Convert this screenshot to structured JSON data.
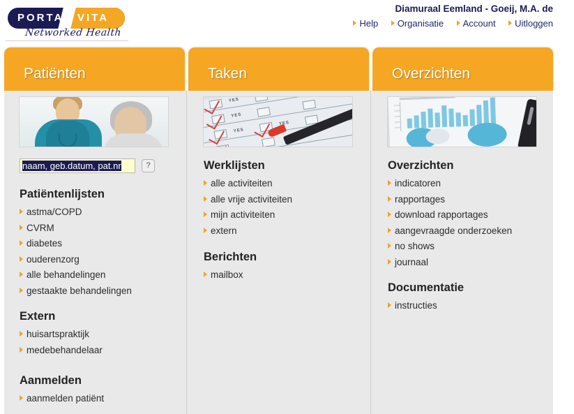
{
  "brand": {
    "logo_left": "PORTA",
    "logo_right": "VITA",
    "tagline": "Networked Health",
    "accent_orange": "#f5a623",
    "navy": "#1b1b54"
  },
  "header": {
    "organisation": "Diamuraal Eemland - Goeij, M.A. de",
    "nav": [
      {
        "label": "Help"
      },
      {
        "label": "Organisatie"
      },
      {
        "label": "Account"
      },
      {
        "label": "Uitloggen"
      }
    ]
  },
  "tabs": [
    {
      "label": "Patiënten"
    },
    {
      "label": "Taken"
    },
    {
      "label": "Overzichten"
    }
  ],
  "columns": [
    {
      "tab": "Patiënten",
      "image_alt": "nurse-and-patient-photo",
      "search": {
        "value": "naam, geb.datum, pat.nr",
        "placeholder": "naam, geb.datum, pat.nr",
        "help_label": "?"
      },
      "groups": [
        {
          "title": "Patiëntenlijsten",
          "links": [
            "astma/COPD",
            "CVRM",
            "diabetes",
            "ouderenzorg",
            "alle behandelingen",
            "gestaakte behandelingen"
          ]
        },
        {
          "title": "Extern",
          "links": [
            "huisartspraktijk",
            "medebehandelaar"
          ]
        },
        {
          "title": "Aanmelden",
          "links": [
            "aanmelden patiënt"
          ]
        }
      ]
    },
    {
      "tab": "Taken",
      "image_alt": "checklist-with-pen-photo",
      "groups": [
        {
          "title": "Werklijsten",
          "links": [
            "alle activiteiten",
            "alle vrije activiteiten",
            "mijn activiteiten",
            "extern"
          ]
        },
        {
          "title": "Berichten",
          "links": [
            "mailbox"
          ]
        }
      ]
    },
    {
      "tab": "Overzichten",
      "image_alt": "charts-report-with-pen-photo",
      "groups": [
        {
          "title": "Overzichten",
          "links": [
            "indicatoren",
            "rapportages",
            "download rapportages",
            "aangevraagde onderzoeken",
            "no shows",
            "journaal"
          ]
        },
        {
          "title": "Documentatie",
          "links": [
            "instructies"
          ]
        }
      ]
    }
  ]
}
